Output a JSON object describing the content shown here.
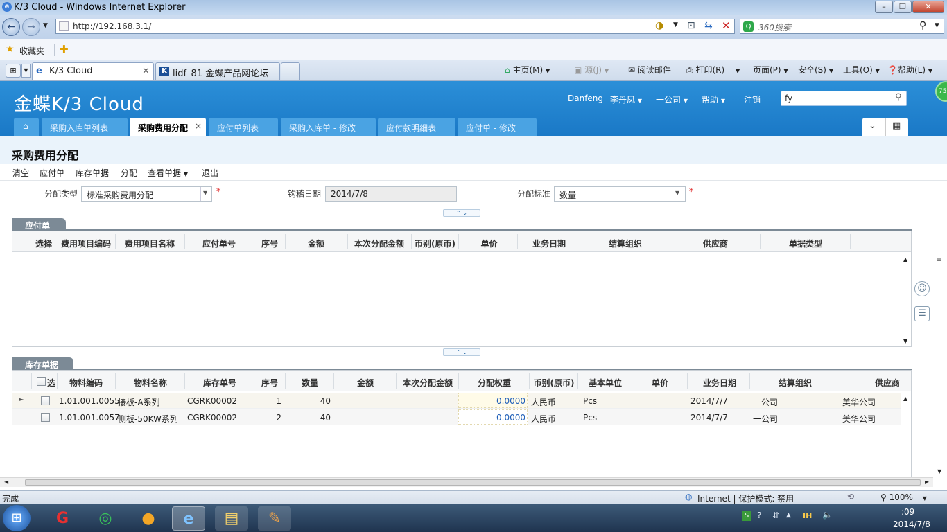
{
  "browser": {
    "window_title": "K/3 Cloud - Windows Internet Explorer",
    "url": "http://192.168.3.1/",
    "search_placeholder": "360搜索",
    "favorites_label": "收藏夹",
    "tabs": [
      {
        "label": "K/3 Cloud",
        "close": "×"
      },
      {
        "label": "lidf_81 金蝶产品网论坛"
      }
    ],
    "commands": [
      "主页(M)",
      "源(J)",
      "阅读邮件",
      "打印(R)",
      "页面(P)",
      "安全(S)",
      "工具(O)",
      "帮助(L)"
    ]
  },
  "app": {
    "logo": "金蝶K/3 Cloud",
    "header_links": [
      "Danfeng",
      "李丹凤",
      "一公司",
      "帮助",
      "注销"
    ],
    "search_value": "fy",
    "tabs": [
      "采购入库单列表",
      "采购费用分配",
      "应付单列表",
      "采购入库单 - 修改",
      "应付款明细表",
      "应付单 - 修改"
    ],
    "tab_close": "×",
    "page_title": "采购费用分配",
    "toolbar": [
      "清空",
      "应付单",
      "库存单据",
      "分配",
      "查看单据",
      "退出"
    ],
    "form": {
      "alloc_type_label": "分配类型",
      "alloc_type_value": "标准采购费用分配",
      "check_date_label": "钩稽日期",
      "check_date_value": "2014/7/8",
      "alloc_basis_label": "分配标准",
      "alloc_basis_value": "数量",
      "required_mark": "*"
    },
    "payable": {
      "section_title": "应付单",
      "columns": [
        "选择",
        "费用项目编码",
        "费用项目名称",
        "应付单号",
        "序号",
        "金额",
        "本次分配金额",
        "币别(原币)",
        "单价",
        "业务日期",
        "结算组织",
        "供应商",
        "单据类型"
      ]
    },
    "stock": {
      "section_title": "库存单据",
      "columns": [
        "选",
        "物料编码",
        "物料名称",
        "库存单号",
        "序号",
        "数量",
        "金额",
        "本次分配金额",
        "分配权重",
        "币别(原币)",
        "基本单位",
        "单价",
        "业务日期",
        "结算组织",
        "供应商"
      ],
      "rows": [
        {
          "code": "1.01.001.0055",
          "name": "接板-A系列",
          "bill": "CGRK00002",
          "seq": "1",
          "qty": "40",
          "weight": "0.0000",
          "currency": "人民币",
          "unit": "Pcs",
          "date": "2014/7/7",
          "org": "一公司",
          "supplier": "美华公司"
        },
        {
          "code": "1.01.001.0057",
          "name": "侧板-50KW系列",
          "bill": "CGRK00002",
          "seq": "2",
          "qty": "40",
          "weight": "0.0000",
          "currency": "人民币",
          "unit": "Pcs",
          "date": "2014/7/7",
          "org": "一公司",
          "supplier": "美华公司"
        }
      ]
    }
  },
  "statusbar": {
    "left": "完成",
    "zone": "Internet | 保护模式: 禁用",
    "zoom": "100%"
  },
  "taskbar": {
    "time": ":09",
    "date": "2014/7/8"
  }
}
